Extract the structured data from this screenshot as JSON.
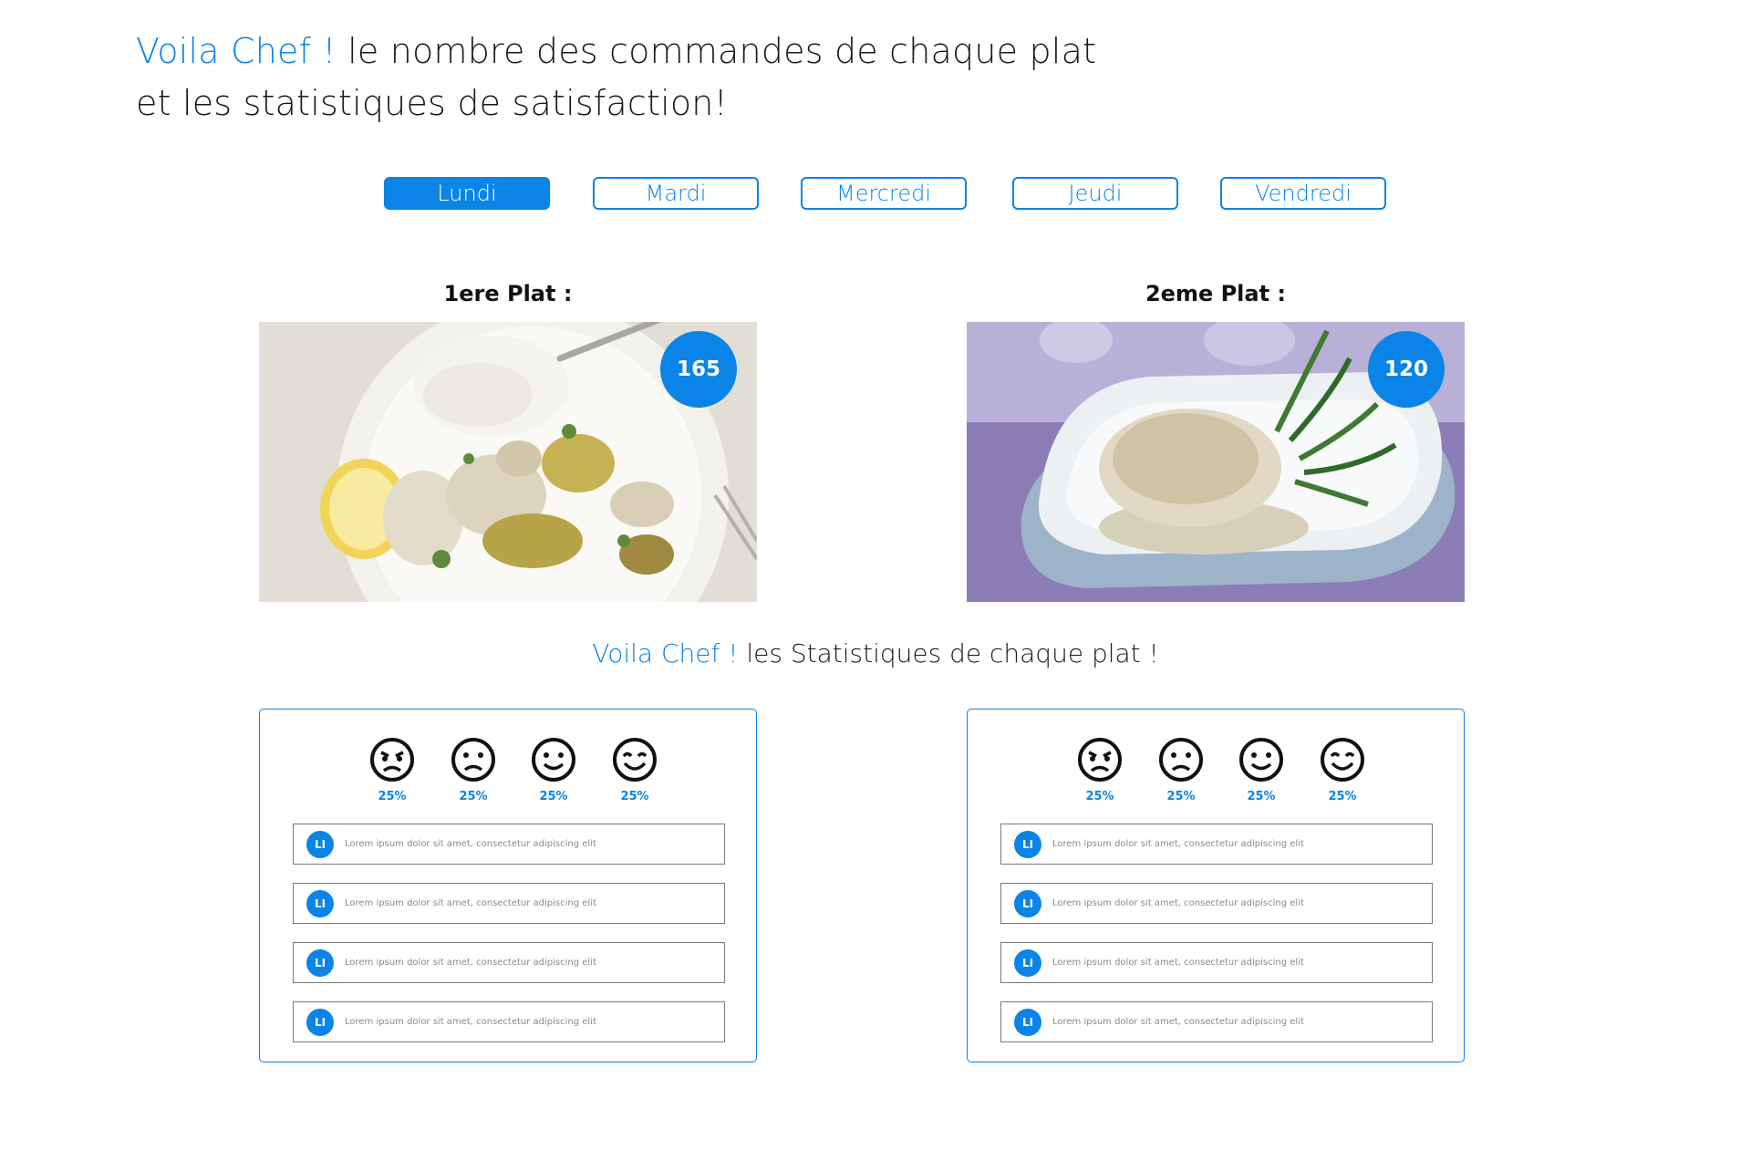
{
  "header": {
    "title_accent": "Voila Chef !",
    "title_line1_rest": " le nombre des commandes de chaque plat",
    "title_line2": "et les statistiques de satisfaction!"
  },
  "days": [
    {
      "label": "Lundi",
      "active": true
    },
    {
      "label": "Mardi",
      "active": false
    },
    {
      "label": "Mercredi",
      "active": false
    },
    {
      "label": "Jeudi",
      "active": false
    },
    {
      "label": "Vendredi",
      "active": false
    }
  ],
  "plats": [
    {
      "title": "1ere Plat :",
      "orders": "165"
    },
    {
      "title": "2eme Plat :",
      "orders": "120"
    }
  ],
  "stats_heading": {
    "accent": "Voila Chef !",
    "rest": " les Statistiques de chaque plat !"
  },
  "stats": [
    {
      "ratings": [
        {
          "icon": "angry-face-icon",
          "percent": "25%"
        },
        {
          "icon": "sad-face-icon",
          "percent": "25%"
        },
        {
          "icon": "smile-face-icon",
          "percent": "25%"
        },
        {
          "icon": "happy-face-icon",
          "percent": "25%"
        }
      ],
      "comments": [
        {
          "avatar": "LI",
          "text": "Lorem ipsum dolor sit amet, consectetur adipiscing elit"
        },
        {
          "avatar": "LI",
          "text": "Lorem ipsum dolor sit amet, consectetur adipiscing elit"
        },
        {
          "avatar": "LI",
          "text": "Lorem ipsum dolor sit amet, consectetur adipiscing elit"
        },
        {
          "avatar": "LI",
          "text": "Lorem ipsum dolor sit amet, consectetur adipiscing elit"
        }
      ]
    },
    {
      "ratings": [
        {
          "icon": "angry-face-icon",
          "percent": "25%"
        },
        {
          "icon": "sad-face-icon",
          "percent": "25%"
        },
        {
          "icon": "smile-face-icon",
          "percent": "25%"
        },
        {
          "icon": "happy-face-icon",
          "percent": "25%"
        }
      ],
      "comments": [
        {
          "avatar": "LI",
          "text": "Lorem ipsum dolor sit amet, consectetur adipiscing elit"
        },
        {
          "avatar": "LI",
          "text": "Lorem ipsum dolor sit amet, consectetur adipiscing elit"
        },
        {
          "avatar": "LI",
          "text": "Lorem ipsum dolor sit amet, consectetur adipiscing elit"
        },
        {
          "avatar": "LI",
          "text": "Lorem ipsum dolor sit amet, consectetur adipiscing elit"
        }
      ]
    }
  ],
  "colors": {
    "accent": "#0a84e6",
    "text": "#1a1a1a"
  }
}
